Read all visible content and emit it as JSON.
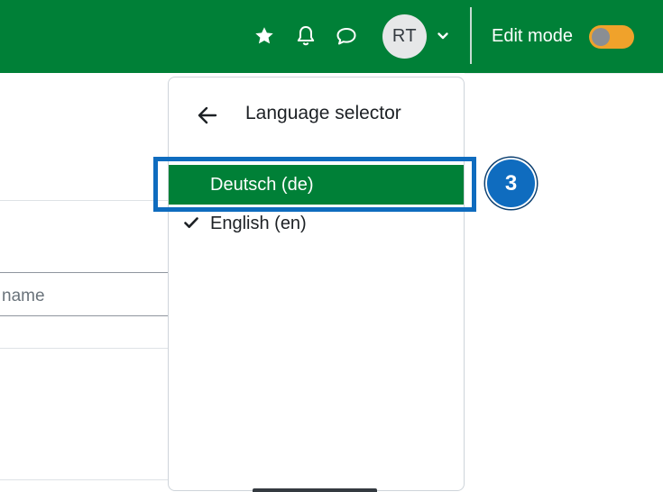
{
  "navbar": {
    "avatar_initials": "RT",
    "edit_mode_label": "Edit mode",
    "edit_mode_on": false,
    "icons": [
      "star-icon",
      "bell-icon",
      "chat-bubble-icon",
      "chevron-down-icon"
    ],
    "brand_color": "#008037"
  },
  "background": {
    "input_placeholder_fragment": "name"
  },
  "language_menu": {
    "title": "Language selector",
    "items": [
      {
        "label": "Deutsch (de)",
        "highlighted": true,
        "checked": false
      },
      {
        "label": "English (en)",
        "highlighted": false,
        "checked": true
      }
    ]
  },
  "annotation": {
    "step_number": "3",
    "color": "#0f6cbf"
  }
}
